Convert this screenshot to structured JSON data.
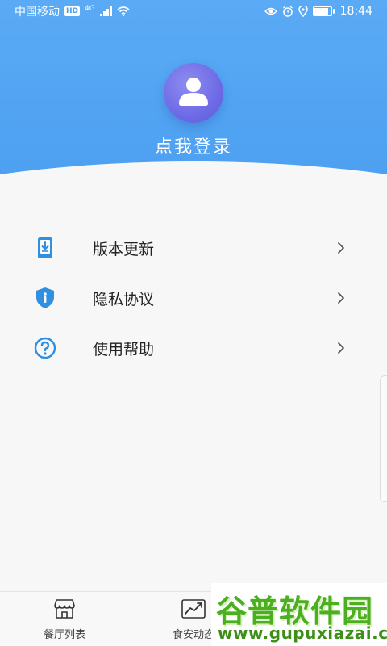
{
  "status_bar": {
    "carrier": "中国移动",
    "hd": "HD",
    "network": "4G",
    "time": "18:44"
  },
  "profile": {
    "login_label": "点我登录",
    "avatar_icon": "user-avatar-icon"
  },
  "menu": {
    "items": [
      {
        "label": "版本更新",
        "icon": "download-update-icon"
      },
      {
        "label": "隐私协议",
        "icon": "privacy-shield-icon"
      },
      {
        "label": "使用帮助",
        "icon": "help-question-icon"
      }
    ]
  },
  "bottom_nav": {
    "items": [
      {
        "label": "餐厅列表",
        "icon": "restaurant-store-icon"
      },
      {
        "label": "食安动态",
        "icon": "trend-chart-icon"
      }
    ]
  },
  "watermark": {
    "title": "谷普软件园",
    "url": "www.gupuxiazai.com"
  },
  "colors": {
    "header_blue": "#4b9ff0",
    "avatar_purple": "#6e6be6",
    "icon_blue": "#2f8fe0",
    "watermark_green": "#4caf1f"
  }
}
